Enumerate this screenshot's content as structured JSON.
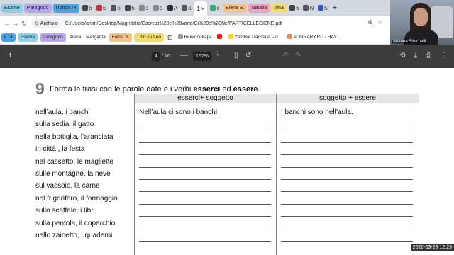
{
  "tabs": {
    "groups_left": [
      {
        "label": "Esame",
        "color": "#8fd0ea"
      },
      {
        "label": "Paragrafo",
        "color": "#b9a8ef"
      },
      {
        "label": "Попок 74",
        "color": "#4aa3e6"
      }
    ],
    "tabs1": [
      {
        "text": "6",
        "color": "#444"
      },
      {
        "text": "S",
        "color": "#c33"
      },
      {
        "text": "o",
        "color": "#555"
      },
      {
        "text": "6",
        "color": "#444"
      },
      {
        "text": "s",
        "color": "#888"
      },
      {
        "text": "s",
        "color": "#888"
      },
      {
        "text": "A",
        "color": "#333"
      },
      {
        "text": "a",
        "color": "#555"
      }
    ],
    "active_tab": "1",
    "tabs2": [
      {
        "text": "c",
        "color": "#3a7"
      }
    ],
    "groups_right": [
      {
        "label": "Elena S.",
        "color": "#f6c38a"
      },
      {
        "label": "Natalia",
        "color": "#f39fc8"
      },
      {
        "label": "Irina",
        "color": "#f3dc6a"
      }
    ],
    "tabs3": [
      {
        "text": "6",
        "color": "#444"
      },
      {
        "text": "N",
        "color": "#555"
      },
      {
        "text": "S",
        "color": "#35c"
      }
    ],
    "new_tab": "+"
  },
  "address": {
    "back": "←",
    "forward": "→",
    "reload": "↻",
    "chip_icon": "⊙",
    "chip_label": "Archivio",
    "url": "C:/Users/arian/Desktop/Magnitalia/Esercizi%20e%20varie/Ci%20e%20Ne/PARTICELLECIENE.pdf",
    "zoom_icon": "⊕",
    "star_icon": "☆"
  },
  "bookmarks": [
    {
      "label": "к 74",
      "color": "#4aa3e6"
    },
    {
      "label": "Esame",
      "color": "#8fd0ea"
    },
    {
      "label": "Paragrafo",
      "color": "#b9a8ef"
    },
    {
      "label": "Alena",
      "color": ""
    },
    {
      "label": "Margarita",
      "color": ""
    },
    {
      "label": "Elena S.",
      "color": "#f6c38a"
    },
    {
      "label": "Libri su Leo",
      "color": "#f3dc6a"
    }
  ],
  "bookmark_links": [
    {
      "label": "Викисловарь",
      "icon_color": "#999"
    },
    {
      "label": "",
      "icon_color": "#e02020"
    },
    {
      "label": "Yandex.Translate – d…",
      "icon_color": "#fc3"
    },
    {
      "label": "eLIBRARY.RU - НАУ…",
      "icon_color": "#e85"
    }
  ],
  "pdf_toolbar": {
    "page_left": "1",
    "current_page": "4",
    "total_pages": "/ 16",
    "zoom": "167%",
    "zoom_minus": "—",
    "zoom_plus": "+",
    "fit_icon": "▯",
    "rotate_icon": "↺",
    "undo_icon": "↶",
    "redo_icon": "↷",
    "print_icon": "⎙",
    "download_icon": "⤓",
    "settings_icon": "⋮",
    "sync_icon": "⟲"
  },
  "exercise": {
    "number": "9",
    "instruction_pre": "Forma le frasi con le parole date e i verbi ",
    "verb1": "esserci",
    "instruction_mid": " ed ",
    "verb2": "essere",
    "instruction_post": ".",
    "col1_header": "esserci+ soggetto",
    "col2_header": "soggetto + essere",
    "rows": [
      {
        "label": "nell’aula, i banchi",
        "ans1": "Nell’aula ci sono i banchi.",
        "ans2": "I banchi sono nell’aula."
      },
      {
        "label": "sulla sedia, il gatto",
        "ans1": "",
        "ans2": ""
      },
      {
        "label": "nella bottiglia, l’aranciata",
        "ans1": "",
        "ans2": ""
      },
      {
        "label": "in città , la festa",
        "ans1": "",
        "ans2": ""
      },
      {
        "label": "nel cassetto, le magliette",
        "ans1": "",
        "ans2": ""
      },
      {
        "label": "sulle montagne, la neve",
        "ans1": "",
        "ans2": ""
      },
      {
        "label": "sul vassoio, la carne",
        "ans1": "",
        "ans2": ""
      },
      {
        "label": "nel frigorifero, il formaggio",
        "ans1": "",
        "ans2": ""
      },
      {
        "label": "sullo scaffale, i libri",
        "ans1": "",
        "ans2": ""
      },
      {
        "label": "sulla pentola, il coperchio",
        "ans1": "",
        "ans2": ""
      },
      {
        "label": "nello zainetto, i quaderni",
        "ans1": "",
        "ans2": ""
      }
    ]
  },
  "webcam": {
    "name": "Arianna Stinchelli"
  },
  "timestamp": "2026-03-28  12:29"
}
